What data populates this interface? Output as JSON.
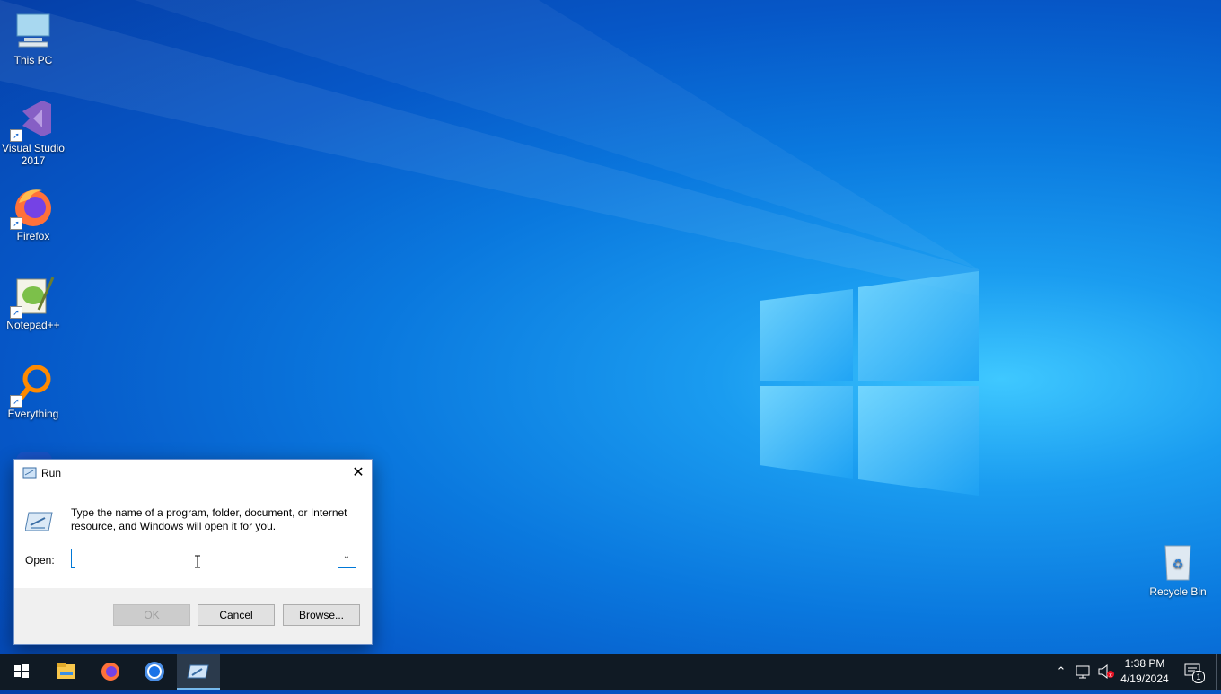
{
  "desktop": {
    "icons": [
      {
        "label_line1": "This PC",
        "label_line2": ""
      },
      {
        "label_line1": "Visual Studio",
        "label_line2": "2017"
      },
      {
        "label_line1": "Firefox",
        "label_line2": ""
      },
      {
        "label_line1": "Notepad++",
        "label_line2": ""
      },
      {
        "label_line1": "Everything",
        "label_line2": ""
      },
      {
        "label_line1": "Recycle Bin",
        "label_line2": ""
      }
    ]
  },
  "run_dialog": {
    "title": "Run",
    "description": "Type the name of a program, folder, document, or Internet resource, and Windows will open it for you.",
    "open_label": "Open:",
    "open_value": "",
    "ok_label": "OK",
    "cancel_label": "Cancel",
    "browse_label": "Browse..."
  },
  "taskbar": {
    "apps": [
      "start-button",
      "file-explorer",
      "firefox",
      "chrome",
      "run"
    ],
    "clock_time": "1:38 PM",
    "clock_date": "4/19/2024",
    "notification_count": "1"
  },
  "colors": {
    "accent": "#0078d7",
    "taskbar": "#101a24"
  }
}
